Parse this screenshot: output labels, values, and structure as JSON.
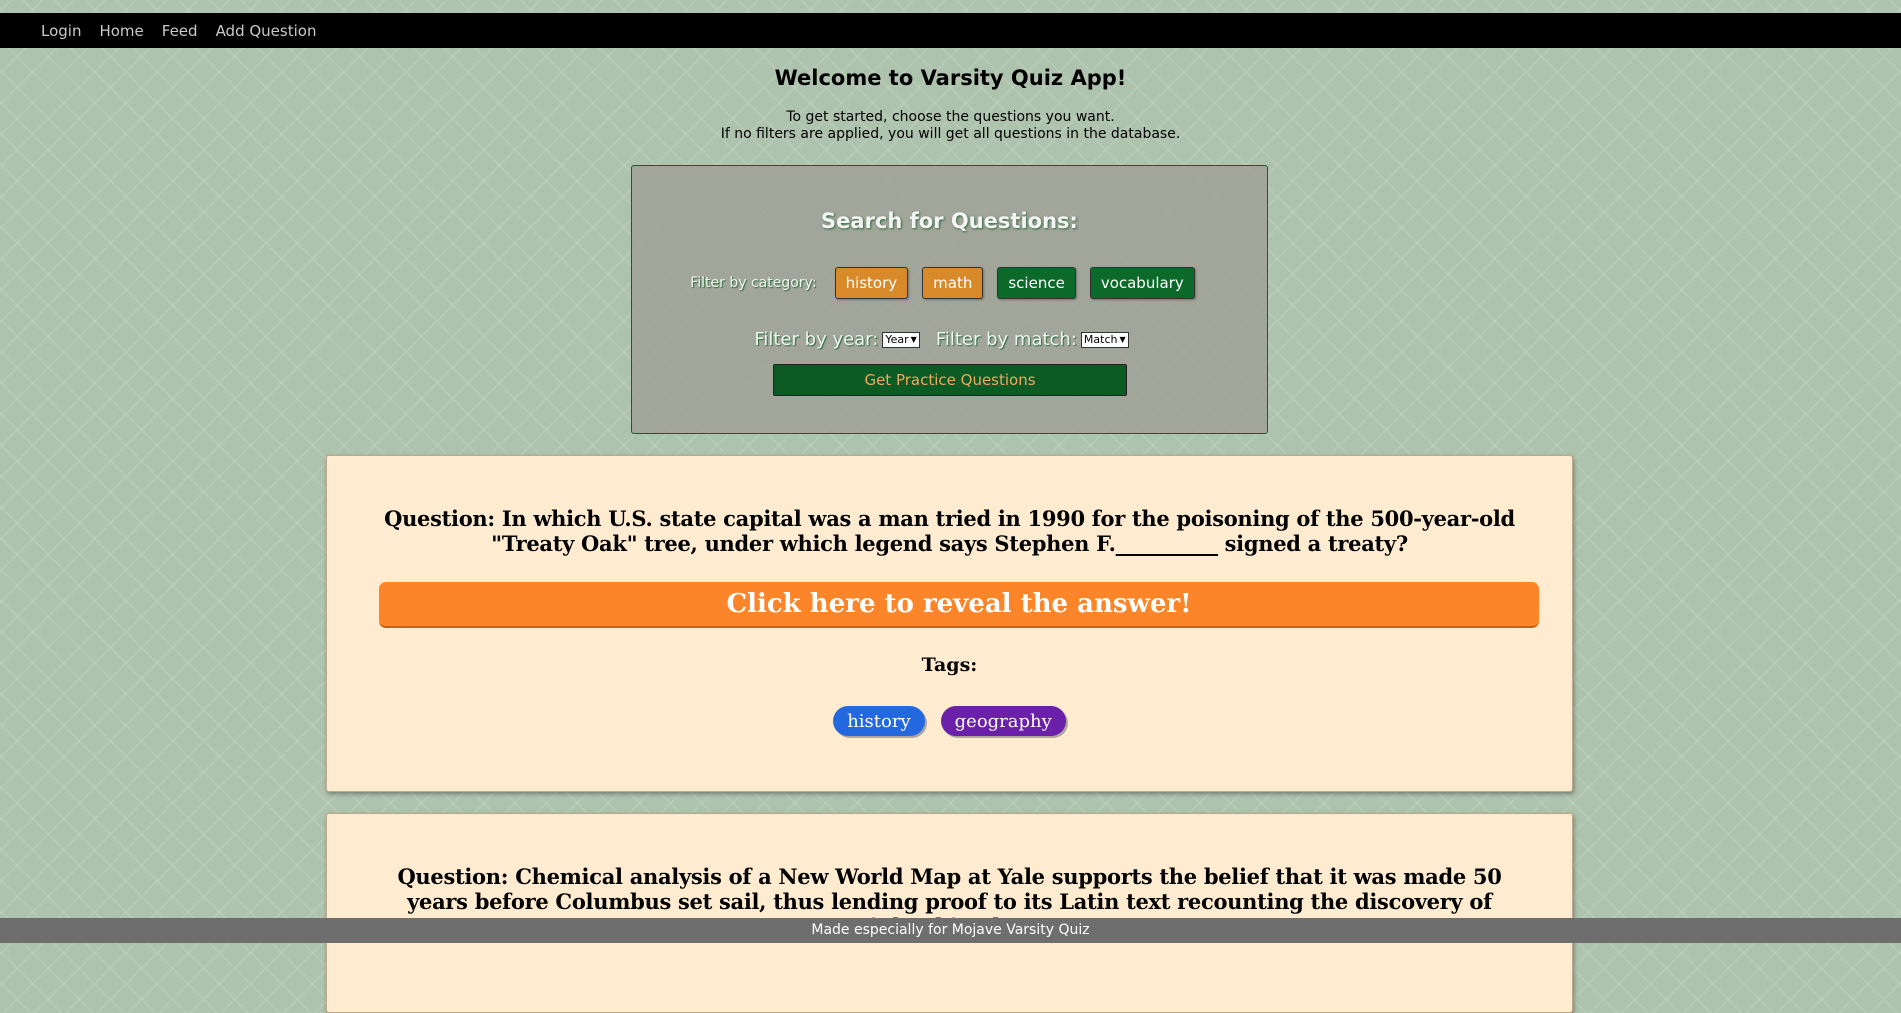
{
  "nav": {
    "items": [
      "Login",
      "Home",
      "Feed",
      "Add Question"
    ]
  },
  "welcome": "Welcome to Varsity Quiz App!",
  "intro": {
    "line1": "To get started, choose the questions you want.",
    "line2": "If no filters are applied, you will get all questions in the database."
  },
  "search": {
    "title": "Search for Questions:",
    "category_label": "Filter by category:",
    "categories": [
      {
        "label": "history",
        "color": "#d8892a"
      },
      {
        "label": "math",
        "color": "#d8892a"
      },
      {
        "label": "science",
        "color": "#0b6a2a"
      },
      {
        "label": "vocabulary",
        "color": "#0b6a2a"
      }
    ],
    "year_label": "Filter by year:",
    "year_selected": "Year",
    "match_label": "Filter by match:",
    "match_selected": "Match",
    "practice_button": "Get Practice Questions"
  },
  "questions": [
    {
      "text": "Question: In which U.S. state capital was a man tried in 1990 for the poisoning of the 500-year-old \"Treaty Oak\" tree, under which legend says Stephen F.__________ signed a treaty?",
      "reveal_label": "Click here to reveal the answer!",
      "tags_label": "Tags:",
      "tags": [
        "history",
        "geography"
      ]
    },
    {
      "text": "Question: Chemical analysis of a New World Map at Yale supports the belief that it was made 50 years before Columbus set sail, thus lending proof to its Latin text recounting the discovery of Vinland in about"
    }
  ],
  "footer": "Made especially for Mojave Varsity Quiz"
}
